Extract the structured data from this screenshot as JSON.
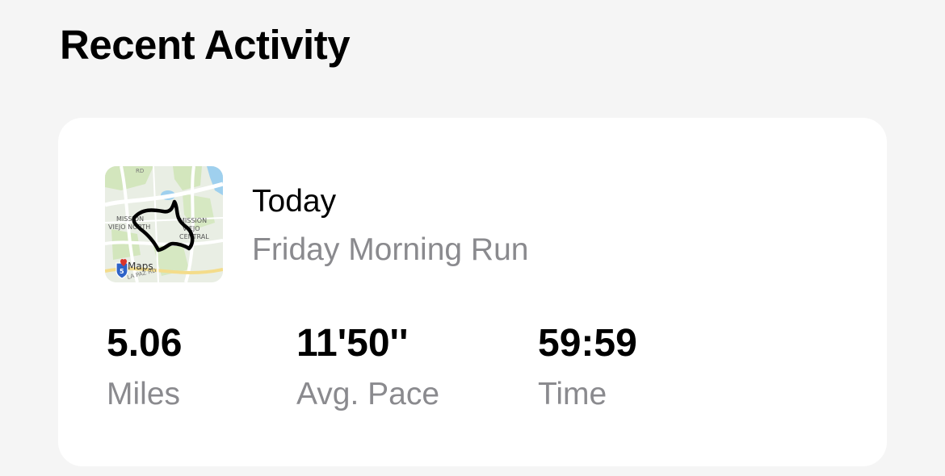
{
  "section": {
    "title": "Recent Activity"
  },
  "activity": {
    "date": "Today",
    "name": "Friday Morning Run",
    "map": {
      "labels": {
        "north_line1": "MISSION",
        "north_line2": "VIEJO NORTH",
        "central_line1": "MISSION",
        "central_line2": "VIEJO",
        "central_line3": "CENTRAL",
        "road_top": "RD",
        "road_bottom": "LA PAZ RD",
        "attribution": "Maps",
        "highway_shield": "5"
      },
      "route_color": "#000000"
    },
    "stats": [
      {
        "value": "5.06",
        "label": "Miles"
      },
      {
        "value": "11'50''",
        "label": "Avg. Pace"
      },
      {
        "value": "59:59",
        "label": "Time"
      }
    ]
  },
  "colors": {
    "background": "#f5f5f5",
    "card": "#ffffff",
    "primary_text": "#000000",
    "secondary_text": "#8a8a8e",
    "water": "#9fd0ee",
    "park": "#cfe3b6"
  }
}
